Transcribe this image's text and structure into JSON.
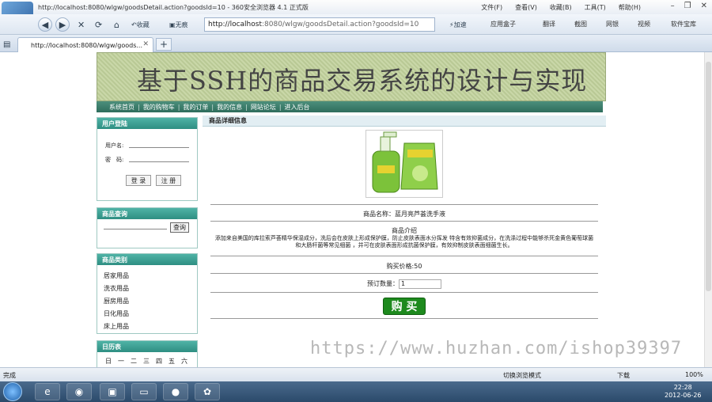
{
  "browser": {
    "title": "http://localhost:8080/wlgw/goodsDetail.action?goodsId=10 - 360安全浏览器 4.1 正式版",
    "menus": [
      "文件(F)",
      "查看(V)",
      "收藏(B)",
      "工具(T)",
      "帮助(H)"
    ],
    "back_label": "收藏",
    "noimg_label": "无痕",
    "address_host": "http://localhost",
    "address_rest": ":8080/wlgw/goodsDetail.action?goodsId=10",
    "accel_label": "加速",
    "toolbar_links": [
      "应用盒子",
      "翻译",
      "截图",
      "网银",
      "视频",
      "软件宝库"
    ],
    "tab_title": "http://localhost:8080/wlgw/goods...",
    "new_tab": "+"
  },
  "page": {
    "banner_title": "基于SSH的商品交易系统的设计与实现",
    "nav": [
      "系统首页",
      "我的购物车",
      "我的订单",
      "我的信息",
      "网站论坛",
      "进入后台"
    ],
    "login": {
      "header": "用户登陆",
      "username_label": "用户名:",
      "password_label": "密　码:",
      "login_btn": "登 录",
      "register_btn": "注 册"
    },
    "search": {
      "header": "商品查询",
      "button": "查询"
    },
    "categories": {
      "header": "商品类别",
      "items": [
        "居家用品",
        "洗衣用品",
        "厨房用品",
        "日化用品",
        "床上用品"
      ]
    },
    "calendar": {
      "header": "日历表",
      "weekdays": [
        "日",
        "一",
        "二",
        "三",
        "四",
        "五",
        "六"
      ]
    },
    "detail": {
      "header": "商品详细信息",
      "name_line": "商品名称：蓝月亮芦荟洗手液",
      "intro_title": "商品介绍",
      "intro_text": "添加来自美国的库拉索芦荟精华保湿成分，洗后会在皮肤上形成保护膜，防止皮肤表面水分挥发 特含有效抑菌成分，在洗涤过程中能够杀死金黄色葡萄球菌和大肠杆菌等常见细菌 ，并可在皮肤表面形成抗菌保护膜，有效抑制皮肤表面细菌生长。",
      "price_line": "购买价格:50",
      "qty_label": "预订数量：",
      "qty_value": "1",
      "buy_btn": "购 买"
    }
  },
  "watermark": "https://www.huzhan.com/ishop39397",
  "status": {
    "left": "完成",
    "mode": "切换浏览模式",
    "download": "下载",
    "zoom": "100%"
  },
  "taskbar": {
    "time": "22:28",
    "date": "2012-06-26"
  },
  "colors": {
    "banner_bg": "#c3d2a0",
    "menubar": "#3c7d6b",
    "sidebox_header": "#3fa295",
    "buy_button": "#1e8a1e"
  }
}
